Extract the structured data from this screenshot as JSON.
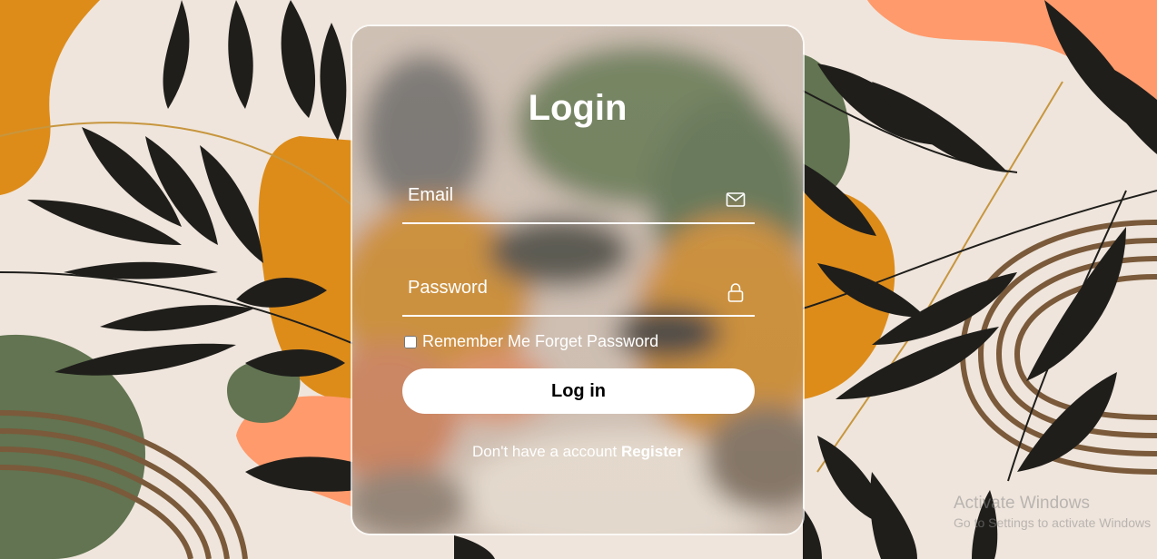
{
  "login": {
    "title": "Login",
    "email_placeholder": "Email",
    "password_placeholder": "Password",
    "remember_forget_label": "Remember Me Forget Password",
    "login_button": "Log in",
    "register_prompt": "Don't have a account",
    "register_link": "Register"
  },
  "icons": {
    "email": "envelope-icon",
    "password": "lock-icon"
  },
  "watermark": {
    "title": "Activate Windows",
    "subtitle": "Go to Settings to activate Windows"
  },
  "colors": {
    "background": "#efe5dc",
    "mustard": "#dd8c1a",
    "salmon": "#ff9a6c",
    "sage": "#627451",
    "leaf": "#1f1e1b",
    "arch": "#7a5a3a",
    "gold_line": "#c7963e"
  }
}
